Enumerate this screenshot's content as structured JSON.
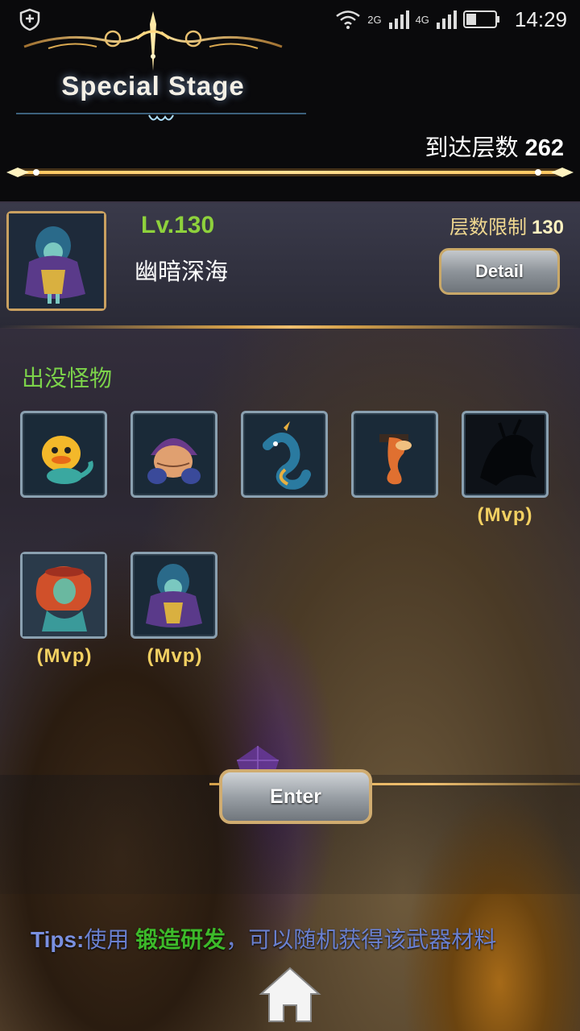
{
  "status_bar": {
    "network_1": "2G",
    "network_2": "4G",
    "time": "14:29"
  },
  "header": {
    "title": "Special Stage",
    "floors_reached_label": "到达层数",
    "floors_reached_value": "262"
  },
  "stage": {
    "level": "Lv.130",
    "name": "幽暗深海",
    "floor_limit_label": "层数限制",
    "floor_limit_value": "130",
    "detail_button": "Detail"
  },
  "monsters": {
    "title": "出没怪物",
    "items": [
      {
        "icon": "yellow-chick-mermaid-icon",
        "mvp": ""
      },
      {
        "icon": "hooded-fish-creature-icon",
        "mvp": ""
      },
      {
        "icon": "blue-sea-serpent-icon",
        "mvp": ""
      },
      {
        "icon": "orange-seahorse-icon",
        "mvp": ""
      },
      {
        "icon": "shadow-monster-icon",
        "mvp": "(Mvp)"
      },
      {
        "icon": "red-haired-mermaid-icon",
        "mvp": "(Mvp)"
      },
      {
        "icon": "deep-sea-witch-icon",
        "mvp": "(Mvp)"
      }
    ]
  },
  "enter_button": "Enter",
  "tips": {
    "label": "Tips:",
    "text_1": "使用 ",
    "highlight": "锻造研发",
    "text_2": "，可以随机获得该武器材料"
  },
  "colors": {
    "level_green": "#8ed13c",
    "monster_title_green": "#7cd34a",
    "mvp_gold": "#f2d062",
    "tips_blue": "#6a80d0",
    "tips_highlight": "#3dba2a",
    "gold_accent": "#d4a04a"
  }
}
